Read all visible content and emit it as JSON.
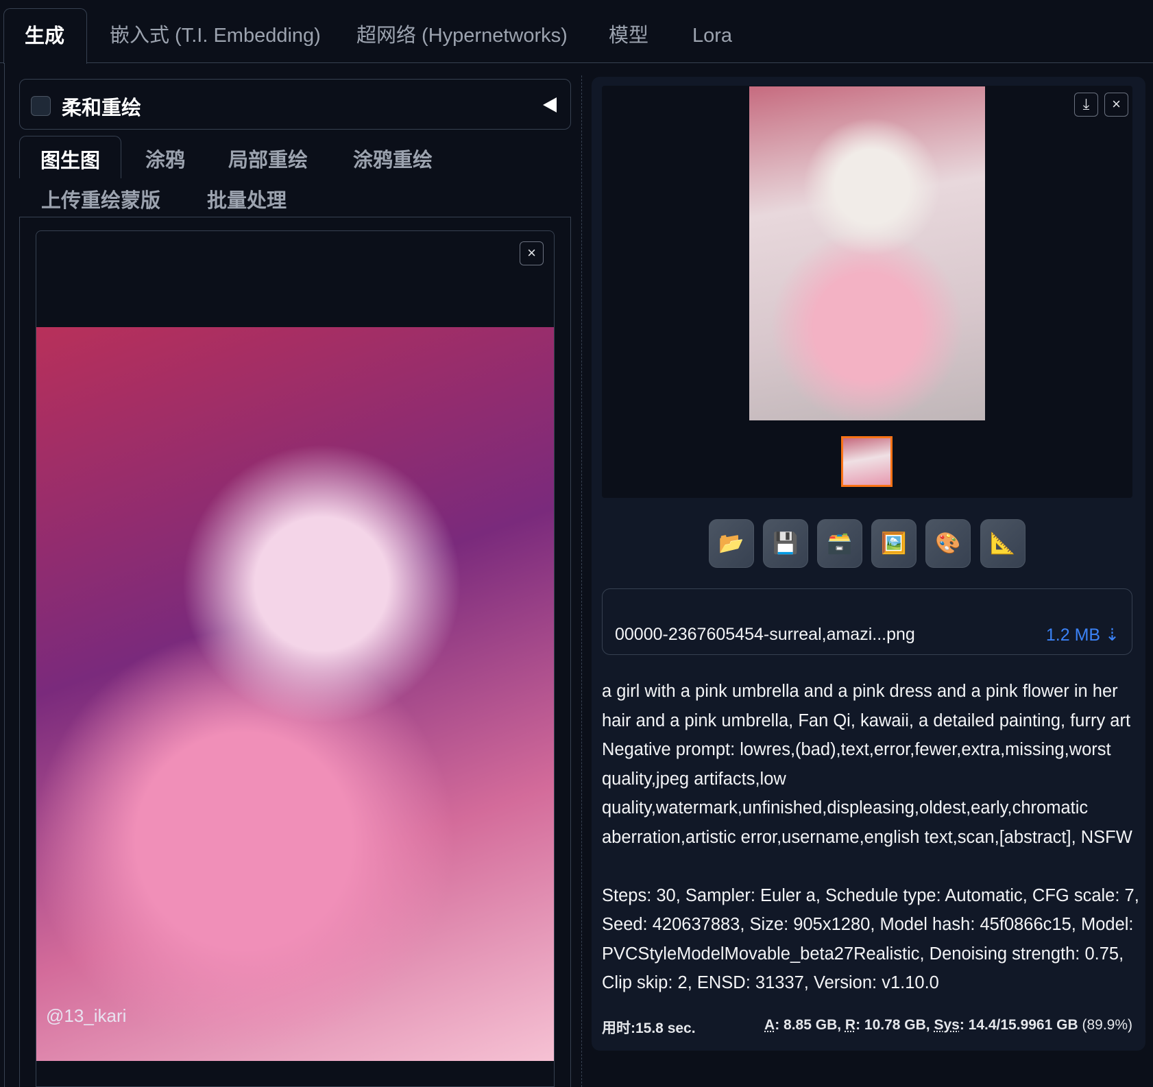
{
  "tabs": [
    "生成",
    "嵌入式 (T.I. Embedding)",
    "超网络 (Hypernetworks)",
    "模型",
    "Lora"
  ],
  "accordion": {
    "label": "柔和重绘",
    "checked": false
  },
  "subtabs": [
    "图生图",
    "涂鸦",
    "局部重绘",
    "涂鸦重绘",
    "上传重绘蒙版",
    "批量处理"
  ],
  "input_image": {
    "watermark": "@13_ikari",
    "close": "×"
  },
  "gallery": {
    "download": "⤓",
    "close": "×"
  },
  "toolbar": [
    {
      "name": "open-folder",
      "icon": "📂"
    },
    {
      "name": "save",
      "icon": "💾"
    },
    {
      "name": "zip",
      "icon": "🗃️"
    },
    {
      "name": "send-to-img2img",
      "icon": "🖼️"
    },
    {
      "name": "send-to-inpaint",
      "icon": "🎨"
    },
    {
      "name": "send-to-extras",
      "icon": "📐"
    }
  ],
  "file": {
    "name": "00000-2367605454-surreal,amazi...png",
    "size": "1.2 MB ⇣"
  },
  "info": {
    "prompt": "a girl with a pink umbrella and a pink dress and a pink flower in her hair and a pink umbrella, Fan Qi, kawaii, a detailed painting, furry art",
    "negative": "Negative prompt: lowres,(bad),text,error,fewer,extra,missing,worst quality,jpeg artifacts,low quality,watermark,unfinished,displeasing,oldest,early,chromatic aberration,artistic error,username,english text,scan,[abstract], NSFW",
    "params": "Steps: 30, Sampler: Euler a, Schedule type: Automatic, CFG scale: 7, Seed: 420637883, Size: 905x1280, Model hash: 45f0866c15, Model: PVCStyleModelMovable_beta27Realistic, Denoising strength: 0.75, Clip skip: 2, ENSD: 31337, Version: v1.10.0"
  },
  "footer": {
    "time": "用时:15.8 sec.",
    "a_label": "A",
    "a": ": 8.85 GB, ",
    "r_label": "R",
    "r": ": 10.78 GB, ",
    "sys_label": "Sys",
    "sys": ": 14.4/15.9961 GB ",
    "pct": "(89.9%)"
  },
  "colors": {
    "background": "#0b0f19",
    "panel": "#111827",
    "accent": "#f97316",
    "link": "#3b82f6"
  }
}
